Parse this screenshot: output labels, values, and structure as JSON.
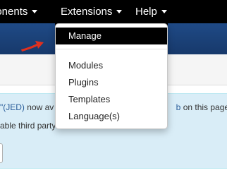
{
  "nav": {
    "components_label": "ponents",
    "extensions_label": "Extensions",
    "help_label": "Help"
  },
  "dropdown": {
    "items": [
      {
        "label": "Manage"
      },
      {
        "label": "Modules"
      },
      {
        "label": "Plugins"
      },
      {
        "label": "Templates"
      },
      {
        "label": "Language(s)"
      }
    ]
  },
  "info": {
    "line1_link": "(JED)",
    "line1_text_before": "now av",
    "line1_link2": "b",
    "line1_text_after": "on this page.",
    "line2_text": "able third party licence terms."
  },
  "colors": {
    "nav_bg": "#000000",
    "header_blue": "#1f4a86",
    "info_bg": "#d9edf7",
    "arrow_red": "#e0301e"
  }
}
